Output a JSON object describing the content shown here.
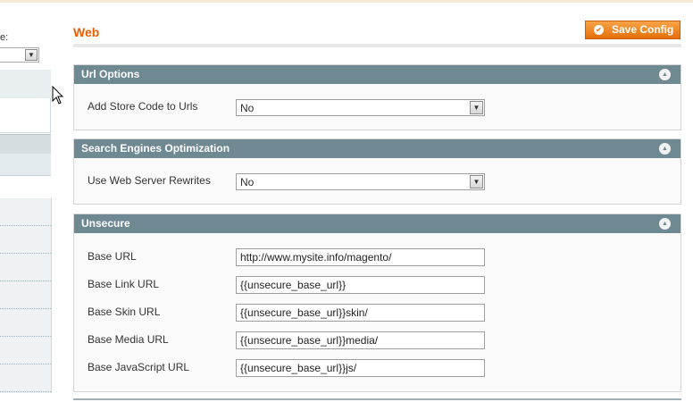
{
  "sidebar": {
    "scope_label": "e:",
    "scope_select_value": ""
  },
  "header": {
    "title": "Web",
    "save_label": "Save Config"
  },
  "sections": {
    "url_options": {
      "title": "Url Options",
      "add_store_code_label": "Add Store Code to Urls",
      "add_store_code_value": "No"
    },
    "seo": {
      "title": "Search Engines Optimization",
      "rewrites_label": "Use Web Server Rewrites",
      "rewrites_value": "No"
    },
    "unsecure": {
      "title": "Unsecure",
      "fields": [
        {
          "label": "Base URL",
          "value": "http://www.mysite.info/magento/"
        },
        {
          "label": "Base Link URL",
          "value": "{{unsecure_base_url}}"
        },
        {
          "label": "Base Skin URL",
          "value": "{{unsecure_base_url}}skin/"
        },
        {
          "label": "Base Media URL",
          "value": "{{unsecure_base_url}}media/"
        },
        {
          "label": "Base JavaScript URL",
          "value": "{{unsecure_base_url}}js/"
        }
      ]
    }
  },
  "colors": {
    "accent": "#eb5e00",
    "section_header": "#6f8992"
  }
}
